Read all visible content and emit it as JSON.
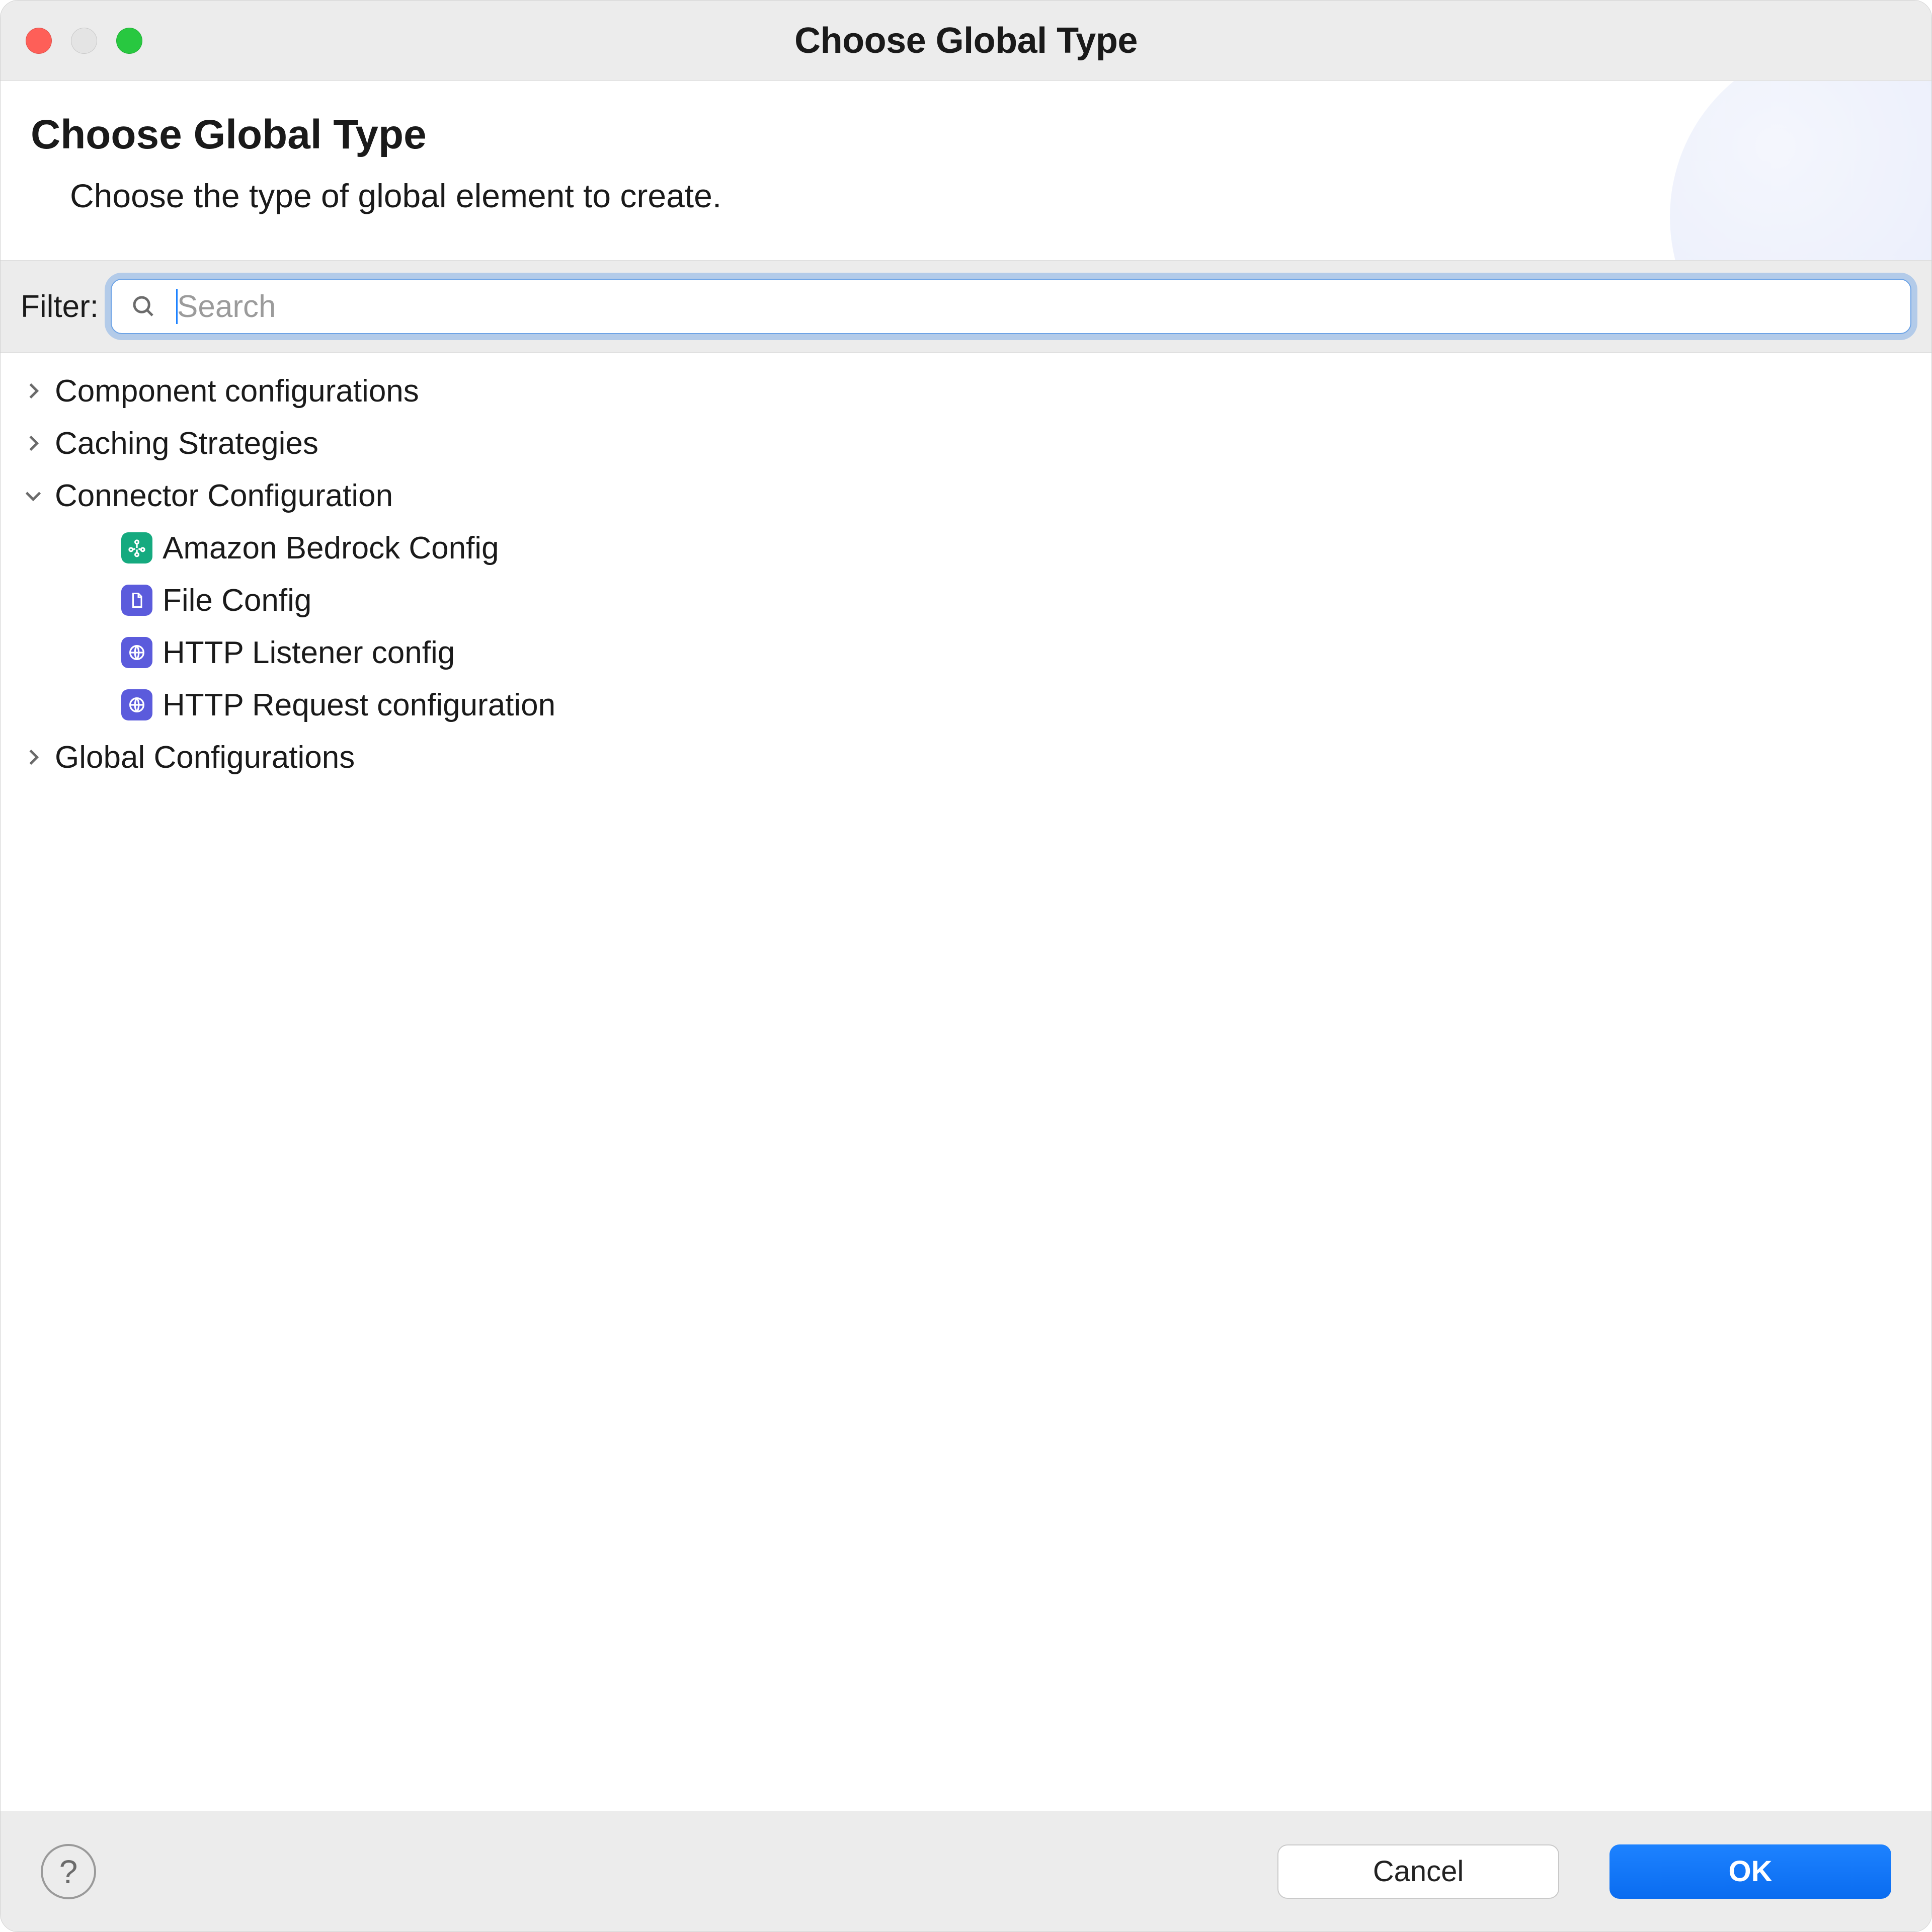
{
  "window": {
    "title": "Choose Global Type"
  },
  "header": {
    "title": "Choose Global Type",
    "subtitle": "Choose the type of global element to create."
  },
  "filter": {
    "label": "Filter:",
    "placeholder": "Search",
    "value": ""
  },
  "tree": {
    "categories": [
      {
        "label": "Component configurations",
        "expanded": false
      },
      {
        "label": "Caching Strategies",
        "expanded": false
      },
      {
        "label": "Connector Configuration",
        "expanded": true,
        "children": [
          {
            "label": "Amazon Bedrock Config",
            "icon": "bedrock-icon",
            "color": "teal"
          },
          {
            "label": "File Config",
            "icon": "file-icon",
            "color": "indigo"
          },
          {
            "label": "HTTP Listener config",
            "icon": "http-listener-icon",
            "color": "indigo"
          },
          {
            "label": "HTTP Request configuration",
            "icon": "http-request-icon",
            "color": "indigo"
          }
        ]
      },
      {
        "label": "Global Configurations",
        "expanded": false
      }
    ]
  },
  "footer": {
    "cancel": "Cancel",
    "ok": "OK",
    "help_tooltip": "?"
  }
}
